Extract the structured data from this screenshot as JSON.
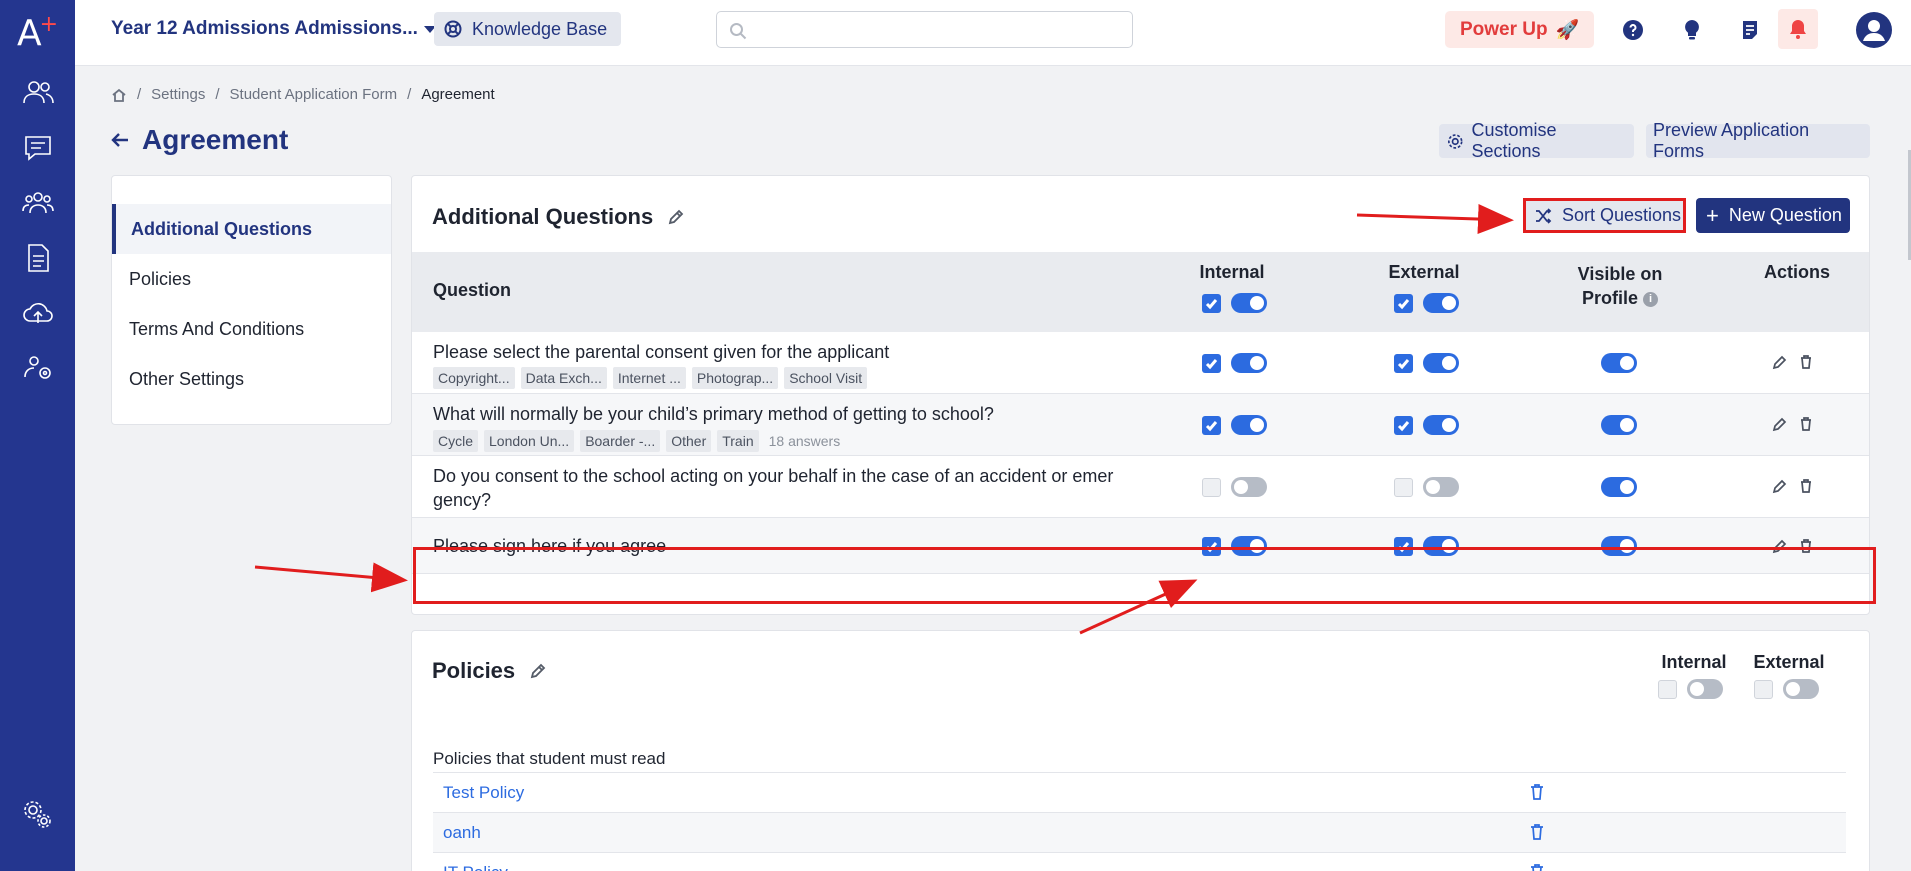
{
  "topbar": {
    "school": "Year 12 Admissions Admissions...",
    "knowledge_base": "Knowledge Base",
    "power_up": "Power Up"
  },
  "breadcrumb": [
    "Settings",
    "Student Application Form",
    "Agreement"
  ],
  "page": {
    "title": "Agreement",
    "customise_sections": "Customise Sections",
    "preview_forms": "Preview Application Forms"
  },
  "menu": [
    "Additional Questions",
    "Policies",
    "Terms And Conditions",
    "Other Settings"
  ],
  "questions": {
    "title": "Additional Questions",
    "sort_button": "Sort Questions",
    "new_button": "New Question",
    "columns": {
      "question": "Question",
      "internal": "Internal",
      "external": "External",
      "visible": "Visible on Profile",
      "actions": "Actions"
    },
    "rows": [
      {
        "text": "Please select the parental consent given for the applicant",
        "chips": [
          "Copyright...",
          "Data Exch...",
          "Internet ...",
          "Photograp...",
          "School Visit"
        ],
        "answers": "",
        "internal": true,
        "external": true,
        "visible": true
      },
      {
        "text": "What will normally be your child’s primary method of getting to school?",
        "chips": [
          "Cycle",
          "London Un...",
          "Boarder -...",
          "Other",
          "Train"
        ],
        "answers": "18 answers",
        "internal": true,
        "external": true,
        "visible": true
      },
      {
        "text_line1": "Do you consent to the school acting on your behalf in the case of an accident or emer",
        "text_line2": "gency?",
        "internal": false,
        "external": false,
        "visible": true
      },
      {
        "text": "Please sign here if you agree",
        "internal": true,
        "external": true,
        "visible": true
      }
    ]
  },
  "policies": {
    "title": "Policies",
    "internal": "Internal",
    "external": "External",
    "subtitle": "Policies that student must read",
    "items": [
      "Test Policy",
      "oanh",
      "IT Policy"
    ]
  },
  "colors": {
    "brand": "#24368f",
    "accent": "#2c6be0",
    "highlight": "#e11d1d"
  }
}
